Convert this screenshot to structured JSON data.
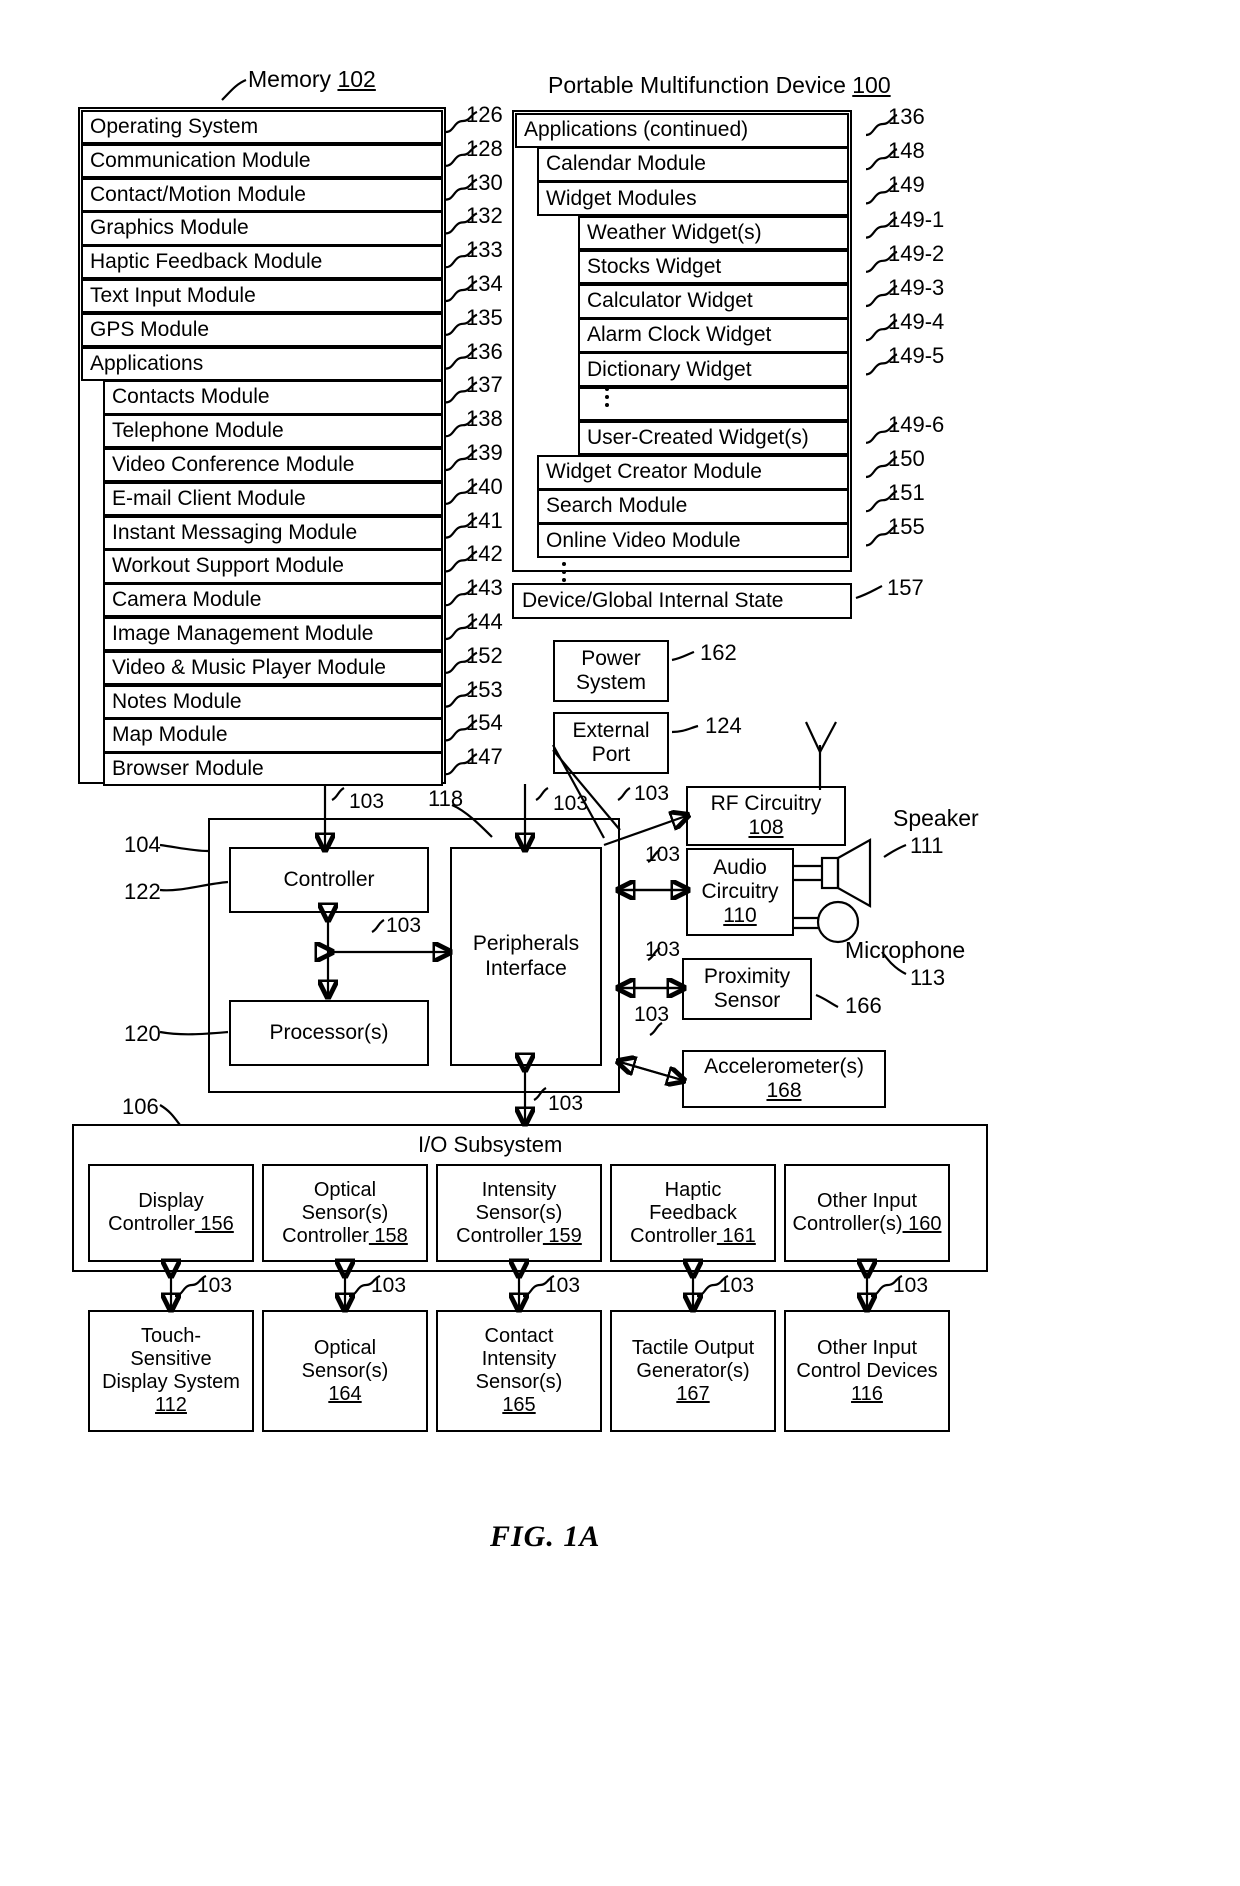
{
  "figure": {
    "caption": "FIG. 1A",
    "memory_title": "Memory",
    "memory_ref": "102",
    "device_title": "Portable Multifunction Device",
    "device_ref": "100"
  },
  "memory_stack": [
    {
      "label": "Operating System",
      "ref": "126",
      "indent": 0
    },
    {
      "label": "Communication Module",
      "ref": "128",
      "indent": 0
    },
    {
      "label": "Contact/Motion Module",
      "ref": "130",
      "indent": 0
    },
    {
      "label": "Graphics Module",
      "ref": "132",
      "indent": 0
    },
    {
      "label": "Haptic Feedback Module",
      "ref": "133",
      "indent": 0
    },
    {
      "label": "Text Input Module",
      "ref": "134",
      "indent": 0
    },
    {
      "label": "GPS Module",
      "ref": "135",
      "indent": 0
    },
    {
      "label": "Applications",
      "ref": "136",
      "indent": 0
    },
    {
      "label": "Contacts Module",
      "ref": "137",
      "indent": 1
    },
    {
      "label": "Telephone Module",
      "ref": "138",
      "indent": 1
    },
    {
      "label": "Video Conference Module",
      "ref": "139",
      "indent": 1
    },
    {
      "label": "E-mail Client Module",
      "ref": "140",
      "indent": 1
    },
    {
      "label": "Instant Messaging Module",
      "ref": "141",
      "indent": 1
    },
    {
      "label": "Workout Support Module",
      "ref": "142",
      "indent": 1
    },
    {
      "label": "Camera Module",
      "ref": "143",
      "indent": 1
    },
    {
      "label": "Image Management Module",
      "ref": "144",
      "indent": 1
    },
    {
      "label": "Video & Music Player Module",
      "ref": "152",
      "indent": 1
    },
    {
      "label": "Notes Module",
      "ref": "153",
      "indent": 1
    },
    {
      "label": "Map Module",
      "ref": "154",
      "indent": 1
    },
    {
      "label": "Browser Module",
      "ref": "147",
      "indent": 1
    }
  ],
  "apps_stack": [
    {
      "label": "Applications (continued)",
      "ref": "136",
      "indent": 0
    },
    {
      "label": "Calendar Module",
      "ref": "148",
      "indent": 1
    },
    {
      "label": "Widget Modules",
      "ref": "149",
      "indent": 1
    },
    {
      "label": "Weather Widget(s)",
      "ref": "149-1",
      "indent": 2
    },
    {
      "label": "Stocks Widget",
      "ref": "149-2",
      "indent": 2
    },
    {
      "label": "Calculator Widget",
      "ref": "149-3",
      "indent": 2
    },
    {
      "label": "Alarm Clock Widget",
      "ref": "149-4",
      "indent": 2
    },
    {
      "label": "Dictionary Widget",
      "ref": "149-5",
      "indent": 2
    },
    {
      "label": "",
      "ref": "",
      "indent": 2
    },
    {
      "label": "User-Created Widget(s)",
      "ref": "149-6",
      "indent": 2
    },
    {
      "label": "Widget Creator Module",
      "ref": "150",
      "indent": 1
    },
    {
      "label": "Search Module",
      "ref": "151",
      "indent": 1
    },
    {
      "label": "Online Video Module",
      "ref": "155",
      "indent": 1
    }
  ],
  "device_state": {
    "label": "Device/Global Internal State",
    "ref": "157"
  },
  "blocks": {
    "power_system": {
      "line1": "Power",
      "line2": "System",
      "ref": "162"
    },
    "external_port": {
      "line1": "External",
      "line2": "Port",
      "ref": "124"
    },
    "rf_circuitry": {
      "line1": "RF Circuitry",
      "num": "108",
      "ref": ""
    },
    "audio_circuitry": {
      "line1": "Audio",
      "line2": "Circuitry",
      "num": "110"
    },
    "proximity": {
      "line1": "Proximity",
      "line2": "Sensor",
      "ref": "166"
    },
    "accelerometer": {
      "line1": "Accelerometer(s)",
      "num": "168"
    },
    "controller": {
      "label": "Controller",
      "ref_left": "122",
      "ref_top": "104"
    },
    "processors": {
      "label": "Processor(s)",
      "ref_left": "120"
    },
    "peripherals": {
      "line1": "Peripherals",
      "line2": "Interface",
      "ref": "118"
    },
    "speaker": {
      "label": "Speaker",
      "ref": "111"
    },
    "microphone": {
      "label": "Microphone",
      "ref": "113"
    },
    "io_subsystem": {
      "label": "I/O Subsystem",
      "ref": "106"
    }
  },
  "io_controllers": [
    {
      "line1": "Display",
      "line2": "Controller",
      "num": "156"
    },
    {
      "line1": "Optical",
      "line2": "Sensor(s)",
      "line3": "Controller",
      "num": "158"
    },
    {
      "line1": "Intensity",
      "line2": "Sensor(s)",
      "line3": "Controller",
      "num": "159"
    },
    {
      "line1": "Haptic",
      "line2": "Feedback",
      "line3": "Controller",
      "num": "161"
    },
    {
      "line1": "Other Input",
      "line2": "Controller(s)",
      "num": "160"
    }
  ],
  "io_devices": [
    {
      "line1": "Touch-",
      "line2": "Sensitive",
      "line3": "Display System",
      "num": "112"
    },
    {
      "line1": "Optical",
      "line2": "Sensor(s)",
      "num": "164"
    },
    {
      "line1": "Contact",
      "line2": "Intensity",
      "line3": "Sensor(s)",
      "num": "165"
    },
    {
      "line1": "Tactile Output",
      "line2": "Generator(s)",
      "num": "167"
    },
    {
      "line1": "Other Input",
      "line2": "Control Devices",
      "num": "116"
    }
  ],
  "bus_labels": {
    "b103": "103"
  }
}
